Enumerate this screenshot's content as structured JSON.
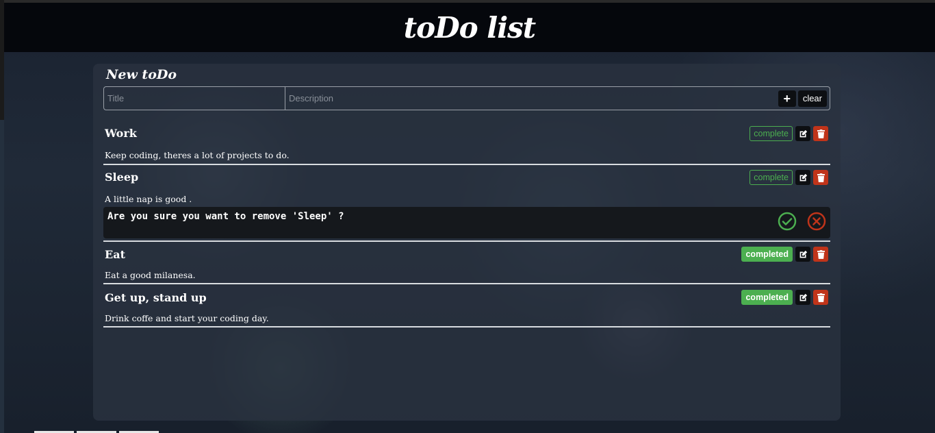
{
  "header": {
    "title": "toDo list"
  },
  "new_todo": {
    "heading": "New toDo",
    "title_placeholder": "Title",
    "description_placeholder": "Description",
    "add_label": "+",
    "clear_label": "clear"
  },
  "todos": [
    {
      "title": "Work",
      "description": "Keep coding, theres a lot of projects to do.",
      "status": "complete"
    },
    {
      "title": "Sleep",
      "description": "A little nap is good .",
      "status": "complete"
    },
    {
      "title": "Eat",
      "description": "Eat a good milanesa.",
      "status": "completed"
    },
    {
      "title": "Get up, stand up",
      "description": "Drink coffe and start your coding day.",
      "status": "completed"
    }
  ],
  "confirm": {
    "message": "Are you sure you want to remove 'Sleep' ?"
  },
  "icons": {
    "edit": "edit-icon",
    "delete": "trash-icon",
    "confirm_yes": "check-circle-icon",
    "confirm_no": "x-circle-icon"
  },
  "colors": {
    "accent_green": "#4caf50",
    "danger_red": "#c0341a"
  }
}
